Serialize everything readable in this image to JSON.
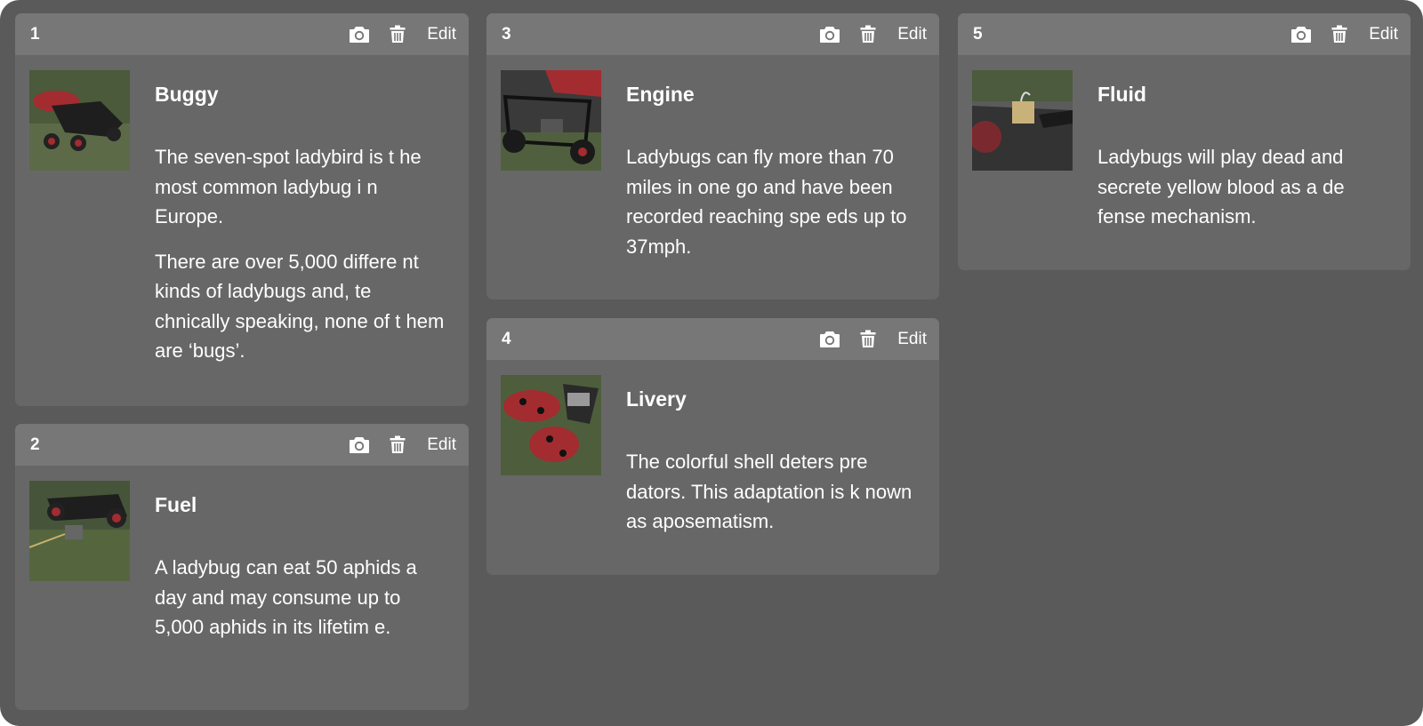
{
  "cards": [
    {
      "number": "1",
      "title": "Buggy",
      "paragraphs": [
        "The seven-spot ladybird is t he most common ladybug i n Europe.",
        "There are over 5,000 differe nt kinds of ladybugs and, te chnically speaking, none of t hem are ‘bugs’."
      ],
      "edit_label": "Edit"
    },
    {
      "number": "2",
      "title": "Fuel",
      "paragraphs": [
        "A ladybug can eat 50 aphids a day and may consume up to 5,000 aphids in its lifetim e."
      ],
      "edit_label": "Edit"
    },
    {
      "number": "3",
      "title": "Engine",
      "paragraphs": [
        "Ladybugs can fly more than 70 miles in one go and have been recorded reaching spe eds up to 37mph."
      ],
      "edit_label": "Edit"
    },
    {
      "number": "4",
      "title": "Livery",
      "paragraphs": [
        "The colorful shell deters pre dators. This adaptation is k nown as aposematism."
      ],
      "edit_label": "Edit"
    },
    {
      "number": "5",
      "title": "Fluid",
      "paragraphs": [
        "Ladybugs will play dead and secrete yellow blood as a de fense mechanism."
      ],
      "edit_label": "Edit"
    }
  ],
  "icons": {
    "photo": "camera-icon",
    "delete": "trash-icon"
  },
  "colors": {
    "background": "#5a5a5a",
    "card": "#676767",
    "card_header": "#777777",
    "text": "#ffffff"
  }
}
